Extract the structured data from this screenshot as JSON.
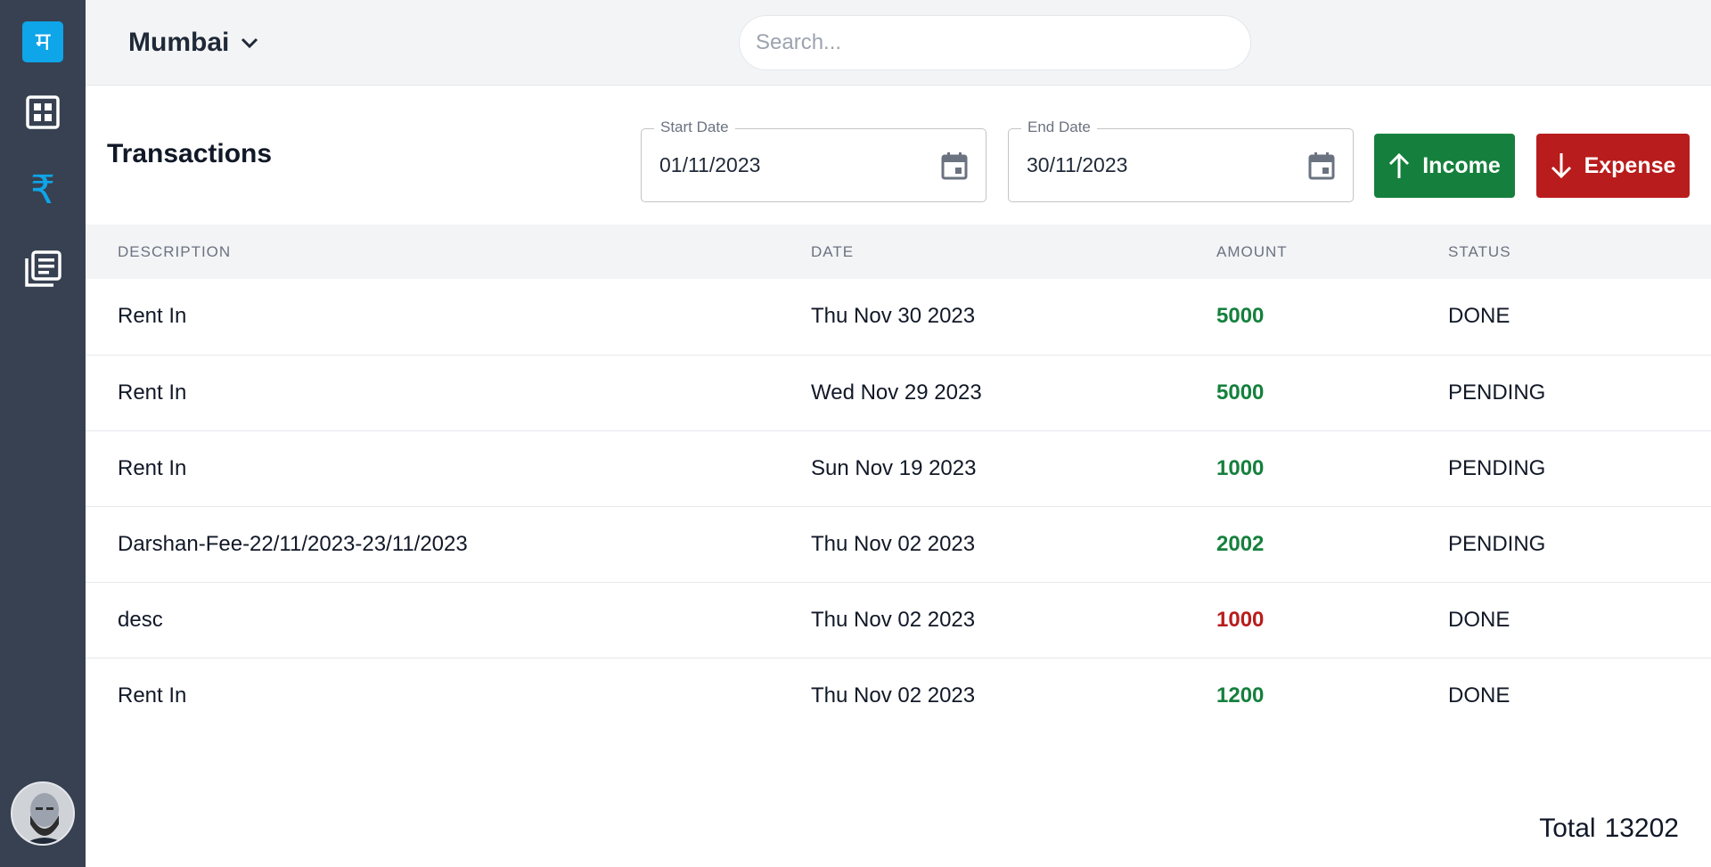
{
  "sidebar": {
    "logo_glyph": "म",
    "nav": [
      {
        "icon": "dashboard-icon"
      },
      {
        "icon": "rupee-icon",
        "glyph": "₹",
        "active": true
      },
      {
        "icon": "documents-icon"
      }
    ],
    "avatar_icon": "user-avatar"
  },
  "topbar": {
    "location": "Mumbai",
    "search_placeholder": "Search..."
  },
  "toolbar": {
    "title": "Transactions",
    "start_date": {
      "label": "Start Date",
      "value": "01/11/2023"
    },
    "end_date": {
      "label": "End Date",
      "value": "30/11/2023"
    },
    "income_label": "Income",
    "expense_label": "Expense"
  },
  "table": {
    "columns": [
      "DESCRIPTION",
      "DATE",
      "AMOUNT",
      "STATUS"
    ],
    "rows": [
      {
        "description": "Rent In",
        "date": "Thu Nov 30 2023",
        "amount": "5000",
        "type": "income",
        "status": "DONE"
      },
      {
        "description": "Rent In",
        "date": "Wed Nov 29 2023",
        "amount": "5000",
        "type": "income",
        "status": "PENDING"
      },
      {
        "description": "Rent In",
        "date": "Sun Nov 19 2023",
        "amount": "1000",
        "type": "income",
        "status": "PENDING"
      },
      {
        "description": "Darshan-Fee-22/11/2023-23/11/2023",
        "date": "Thu Nov 02 2023",
        "amount": "2002",
        "type": "income",
        "status": "PENDING"
      },
      {
        "description": "desc",
        "date": "Thu Nov 02 2023",
        "amount": "1000",
        "type": "expense",
        "status": "DONE"
      },
      {
        "description": "Rent In",
        "date": "Thu Nov 02 2023",
        "amount": "1200",
        "type": "income",
        "status": "DONE"
      }
    ]
  },
  "footer": {
    "total_label": "Total",
    "total_value": "13202"
  },
  "colors": {
    "sidebar_bg": "#374151",
    "accent": "#0ea5e9",
    "income": "#15803d",
    "expense": "#b91c1c"
  }
}
